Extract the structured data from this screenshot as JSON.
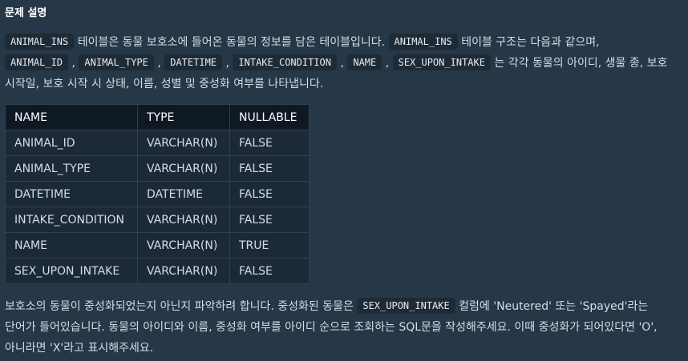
{
  "section": {
    "title": "문제 설명"
  },
  "intro": {
    "table_name": "ANIMAL_INS",
    "text1": " 테이블은 동물 보호소에 들어온 동물의 정보를 담은 테이블입니다. ",
    "text2": " 테이블 구조는 다음과 같으며,",
    "columns": [
      "ANIMAL_ID",
      "ANIMAL_TYPE",
      "DATETIME",
      "INTAKE_CONDITION",
      "NAME",
      "SEX_UPON_INTAKE"
    ],
    "sep": ",",
    "text3": " 는 각각 동물의 아이디, 생물 종, 보호",
    "text4": "시작일, 보호 시작 시 상태, 이름, 성별 및 중성화 여부를 나타냅니다."
  },
  "schema_table": {
    "headers": [
      "NAME",
      "TYPE",
      "NULLABLE"
    ],
    "rows": [
      [
        "ANIMAL_ID",
        "VARCHAR(N)",
        "FALSE"
      ],
      [
        "ANIMAL_TYPE",
        "VARCHAR(N)",
        "FALSE"
      ],
      [
        "DATETIME",
        "DATETIME",
        "FALSE"
      ],
      [
        "INTAKE_CONDITION",
        "VARCHAR(N)",
        "FALSE"
      ],
      [
        "NAME",
        "VARCHAR(N)",
        "TRUE"
      ],
      [
        "SEX_UPON_INTAKE",
        "VARCHAR(N)",
        "FALSE"
      ]
    ]
  },
  "task": {
    "text1": "보호소의 동물이 중성화되었는지 아닌지 파악하려 합니다. 중성화된 동물은 ",
    "code": "SEX_UPON_INTAKE",
    "text2": " 컬럼에 'Neutered' 또는 'Spayed'라는",
    "line2": "단어가 들어있습니다. 동물의 아이디와 이름, 중성화 여부를 아이디 순으로 조회하는 SQL문을 작성해주세요. 이때 중성화가 되어있다면 'O',",
    "line3": "아니라면 'X'라고 표시해주세요."
  }
}
